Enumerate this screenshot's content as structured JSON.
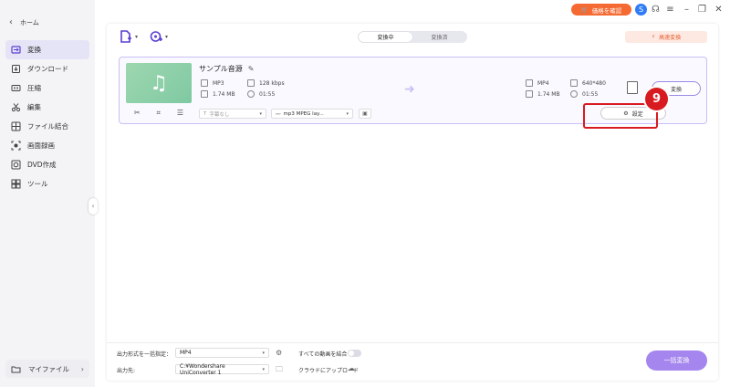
{
  "sidebar": {
    "home_label": "ホーム",
    "items": [
      {
        "label": "変換",
        "icon": "convert-icon",
        "active": true
      },
      {
        "label": "ダウンロード",
        "icon": "download-icon",
        "active": false
      },
      {
        "label": "圧縮",
        "icon": "compress-icon",
        "active": false
      },
      {
        "label": "編集",
        "icon": "scissors-icon",
        "active": false
      },
      {
        "label": "ファイル結合",
        "icon": "merge-icon",
        "active": false
      },
      {
        "label": "画面録画",
        "icon": "screen-record-icon",
        "active": false
      },
      {
        "label": "DVD作成",
        "icon": "dvd-icon",
        "active": false
      },
      {
        "label": "ツール",
        "icon": "toolbox-icon",
        "active": false
      }
    ],
    "myfiles_label": "マイファイル"
  },
  "titlebar": {
    "price_label": "価格を確認",
    "avatar_letter": "S"
  },
  "tabs": {
    "converting": "変換中",
    "converted": "変換済"
  },
  "hispeed_label": "高速変換",
  "file": {
    "name": "サンプル音源",
    "source": {
      "format": "MP3",
      "bitrate": "128 kbps",
      "size": "1.74 MB",
      "duration": "01:55"
    },
    "target": {
      "format": "MP4",
      "resolution": "640*480",
      "size": "1.74 MB",
      "duration": "01:55"
    },
    "subtitle_placeholder": "字幕なし",
    "audio_track": "mp3 MPEG lay...",
    "convert_label": "変換",
    "settings_label": "設定"
  },
  "annotation": {
    "step_number": "9",
    "color": "#d81b20"
  },
  "bottom": {
    "output_format_label": "出力形式を一括指定：",
    "output_format_value": "MP4",
    "merge_label": "すべての動画を結合",
    "output_dest_label": "出力先:",
    "output_dest_value": "C:¥Wondershare UniConverter 1",
    "cloud_upload_label": "クラウドにアップロード",
    "batch_convert_label": "一括変換"
  },
  "colors": {
    "accent": "#a486ee",
    "brand_orange": "#f56a33",
    "selection_border": "#c9bff6"
  }
}
